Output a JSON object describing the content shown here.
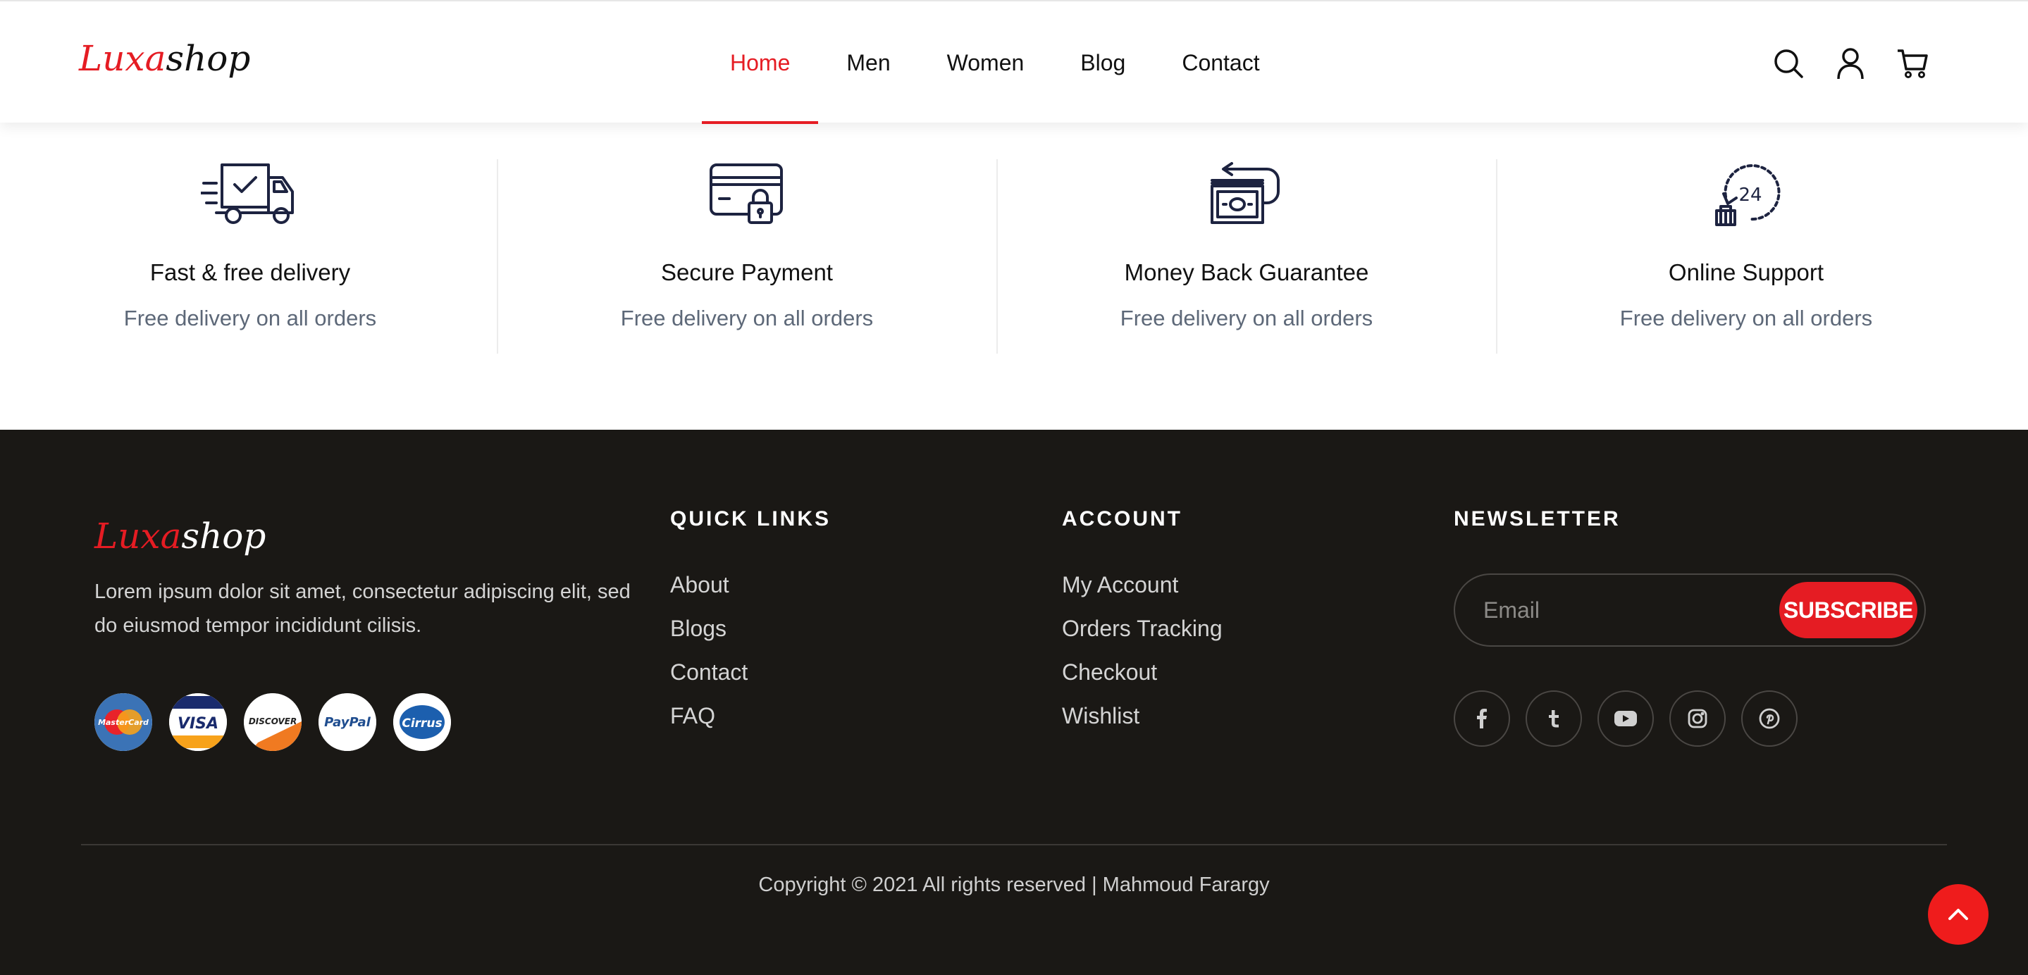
{
  "brand": {
    "logo_part1": "Luxa",
    "logo_part2": "shop",
    "accent_color": "#e51c23"
  },
  "nav": {
    "items": [
      {
        "label": "Home",
        "active": true
      },
      {
        "label": "Men"
      },
      {
        "label": "Women"
      },
      {
        "label": "Blog"
      },
      {
        "label": "Contact"
      }
    ],
    "icons": [
      "search-icon",
      "user-icon",
      "cart-icon"
    ]
  },
  "features": [
    {
      "icon": "delivery-truck-icon",
      "title": "Fast & free delivery",
      "description": "Free delivery on all orders"
    },
    {
      "icon": "secure-card-icon",
      "title": "Secure Payment",
      "description": "Free delivery on all orders"
    },
    {
      "icon": "money-back-icon",
      "title": "Money Back Guarantee",
      "description": "Free delivery on all orders"
    },
    {
      "icon": "support-24-icon",
      "title": "Online Support",
      "description": "Free delivery on all orders"
    }
  ],
  "footer": {
    "about": "Lorem ipsum dolor sit amet, consectetur adipiscing elit, sed do eiusmod tempor incididunt cilisis.",
    "payment_methods": [
      "MasterCard",
      "VISA",
      "DISCOVER",
      "PayPal",
      "Cirrus"
    ],
    "quick_links": {
      "title": "QUICK LINKS",
      "items": [
        "About",
        "Blogs",
        "Contact",
        "FAQ"
      ]
    },
    "account": {
      "title": "ACCOUNT",
      "items": [
        "My Account",
        "Orders Tracking",
        "Checkout",
        "Wishlist"
      ]
    },
    "newsletter": {
      "title": "NEWSLETTER",
      "placeholder": "Email",
      "button_label": "SUBSCRIBE"
    },
    "socials": [
      "facebook-icon",
      "tumblr-icon",
      "youtube-icon",
      "instagram-icon",
      "pinterest-icon"
    ],
    "copyright": "Copyright © 2021 All rights reserved | Mahmoud Farargy"
  }
}
